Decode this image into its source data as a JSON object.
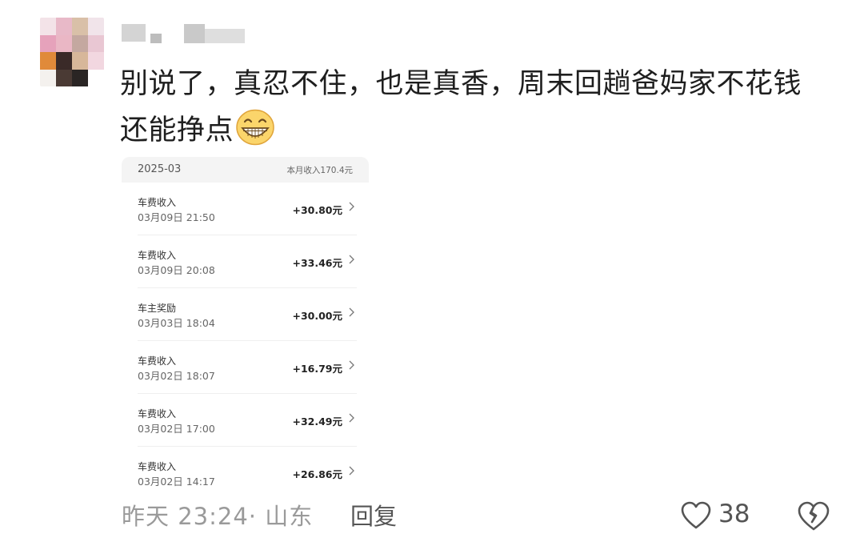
{
  "comment": {
    "line1": "别说了，真忍不住，也是真香，周末回趟爸妈家不花钱",
    "line2": "还能挣点"
  },
  "screenshot": {
    "month": "2025-03",
    "total": "本月收入170.4元",
    "records": [
      {
        "type": "车费收入",
        "time": "03月09日 21:50",
        "amount": "+30.80元"
      },
      {
        "type": "车费收入",
        "time": "03月09日 20:08",
        "amount": "+33.46元"
      },
      {
        "type": "车主奖励",
        "time": "03月03日 18:04",
        "amount": "+30.00元"
      },
      {
        "type": "车费收入",
        "time": "03月02日 18:07",
        "amount": "+16.79元"
      },
      {
        "type": "车费收入",
        "time": "03月02日 17:00",
        "amount": "+32.49元"
      },
      {
        "type": "车费收入",
        "time": "03月02日 14:17",
        "amount": "+26.86元"
      }
    ]
  },
  "footer": {
    "time_location": "昨天 23:24· 山东",
    "reply": "回复",
    "likes": "38"
  },
  "icons": {
    "emoji": "grinning-face-icon",
    "like": "heart-outline-icon",
    "dislike": "broken-heart-icon",
    "chevron": "chevron-right-icon"
  }
}
